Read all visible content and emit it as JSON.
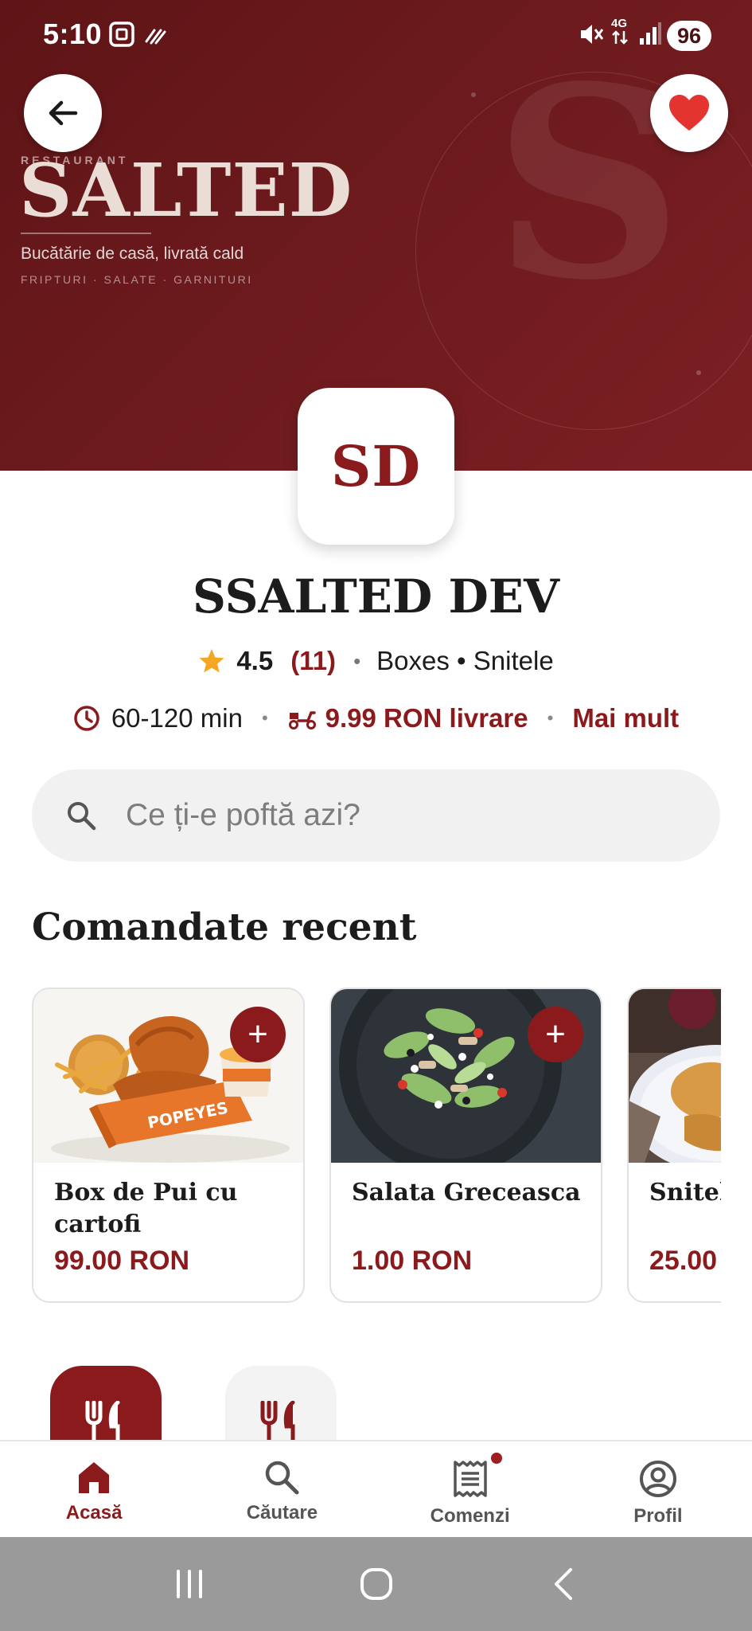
{
  "status_bar": {
    "time": "5:10",
    "network": "4G",
    "battery": "96"
  },
  "hero": {
    "kicker": "RESTAURANT",
    "brand": "SALTED",
    "tagline": "Bucătărie de casă, livrată cald",
    "subline": "FRIPTURI · SALATE · GARNITURI",
    "watermark": "S",
    "background_color": "#6c1a1d"
  },
  "restaurant": {
    "logo_text": "SD",
    "name": "SSALTED DEV",
    "rating": "4.5",
    "rating_count": "(11)",
    "categories": "Boxes • Snitele",
    "delivery_time": "60-120 min",
    "delivery_fee": "9.99 RON livrare",
    "more_label": "Mai mult"
  },
  "search": {
    "placeholder": "Ce ți-e poftă azi?"
  },
  "recent": {
    "title": "Comandate recent",
    "items": [
      {
        "name": "Box de Pui cu cartofi",
        "price": "99.00 RON",
        "add_label": "+"
      },
      {
        "name": "Salata Greceasca",
        "price": "1.00 RON",
        "add_label": "+"
      },
      {
        "name": "Snitel",
        "price": "25.00",
        "add_label": "+"
      }
    ]
  },
  "bottom_nav": {
    "items": [
      {
        "label": "Acasă",
        "icon": "home-icon",
        "active": true
      },
      {
        "label": "Căutare",
        "icon": "search-icon",
        "active": false
      },
      {
        "label": "Comenzi",
        "icon": "receipt-icon",
        "active": false,
        "badge": true
      },
      {
        "label": "Profil",
        "icon": "profile-icon",
        "active": false
      }
    ]
  },
  "colors": {
    "accent": "#8b1a1d",
    "star": "#f5a623",
    "surface": "#f1f1f1"
  }
}
